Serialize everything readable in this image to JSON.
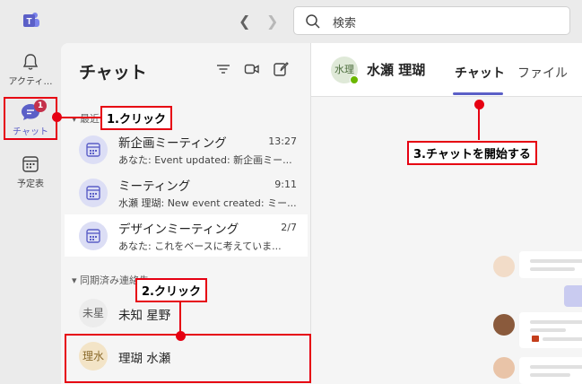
{
  "titlebar": {
    "search_placeholder": "検索"
  },
  "rail": {
    "items": [
      {
        "label": "アクティ…",
        "icon": "bell-icon"
      },
      {
        "label": "チャット",
        "icon": "chat-icon",
        "badge": "1"
      },
      {
        "label": "予定表",
        "icon": "calendar-icon"
      }
    ]
  },
  "chat_list": {
    "title": "チャット",
    "section_recent": "最近",
    "chats": [
      {
        "name": "新企画ミーティング",
        "time": "13:27",
        "preview": "あなた: Event updated: 新企画ミー..."
      },
      {
        "name": "ミーティング",
        "time": "9:11",
        "preview": "水瀬 理瑚: New event created: ミー..."
      },
      {
        "name": "デザインミーティング",
        "time": "2/7",
        "preview": "あなた: これをベースに考えていま..."
      }
    ],
    "section_synced": "同期済み連絡先",
    "contacts": [
      {
        "initials": "未星",
        "name": "未知 星野"
      },
      {
        "initials": "理水",
        "name": "理瑚 水瀬"
      }
    ]
  },
  "main": {
    "avatar_initials": "水理",
    "contact_name": "水瀬 理瑚",
    "tabs": [
      "チャット",
      "ファイル"
    ]
  },
  "annotations": {
    "step1": "1.クリック",
    "step2": "2.クリック",
    "step3": "3.チャットを開始する"
  },
  "colors": {
    "accent": "#5b5fc7",
    "annotation": "#e60012",
    "badge": "#c4314b",
    "presence": "#6bb700"
  }
}
